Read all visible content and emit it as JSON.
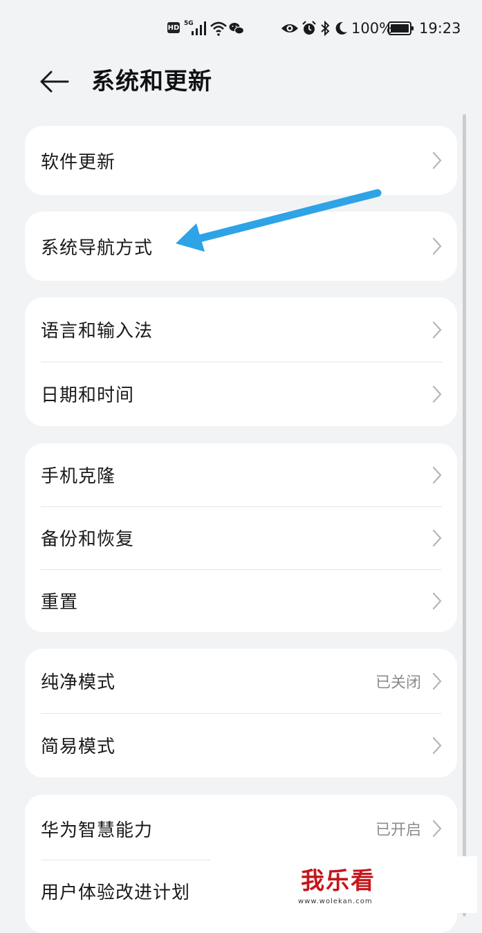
{
  "status_bar": {
    "hd_badge": "HD",
    "network": "5G",
    "battery_percent": "100%",
    "time": "19:23"
  },
  "header": {
    "title": "系统和更新"
  },
  "cards": [
    {
      "rows": [
        {
          "label": "软件更新"
        }
      ]
    },
    {
      "rows": [
        {
          "label": "系统导航方式"
        }
      ]
    },
    {
      "rows": [
        {
          "label": "语言和输入法"
        },
        {
          "label": "日期和时间"
        }
      ]
    },
    {
      "rows": [
        {
          "label": "手机克隆"
        },
        {
          "label": "备份和恢复"
        },
        {
          "label": "重置"
        }
      ]
    },
    {
      "rows": [
        {
          "label": "纯净模式",
          "value": "已关闭"
        },
        {
          "label": "简易模式"
        }
      ]
    },
    {
      "rows": [
        {
          "label": "华为智慧能力",
          "value": "已开启"
        },
        {
          "label": "用户体验改进计划"
        }
      ]
    }
  ],
  "annotation": {
    "color": "#2ea3e6"
  },
  "watermark": {
    "text": "我乐看",
    "url": "www.wolekan.com"
  },
  "colors": {
    "background": "#f1f3f5",
    "card": "#ffffff",
    "secondary_text": "#8c8c8c"
  }
}
